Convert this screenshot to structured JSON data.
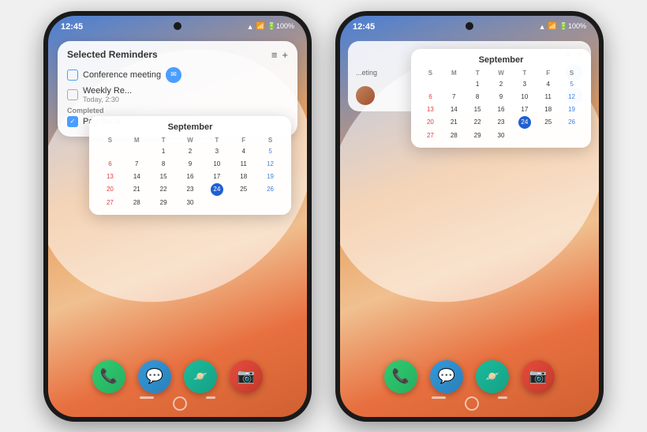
{
  "phone1": {
    "status": {
      "time": "12:45",
      "signal": "WiFi ▲ 100%"
    },
    "widget": {
      "title": "Selected Reminders",
      "items": [
        {
          "text": "Conference meeting",
          "sub": "",
          "checked": false,
          "tag": true
        },
        {
          "text": "Weekly Re...",
          "sub": "Today, 2:30",
          "checked": false,
          "tag": false
        }
      ],
      "completed_label": "Completed",
      "completed_items": [
        {
          "text": "Pay-the-b...",
          "checked": true
        }
      ]
    },
    "calendar": {
      "month": "September",
      "days_header": [
        "S",
        "M",
        "T",
        "W",
        "T",
        "F",
        "S"
      ],
      "rows": [
        [
          "",
          "",
          "1",
          "2",
          "3",
          "4",
          "5"
        ],
        [
          "6",
          "7",
          "8",
          "9",
          "10",
          "11",
          "12"
        ],
        [
          "13",
          "14",
          "15",
          "16",
          "17",
          "18",
          "19"
        ],
        [
          "20",
          "21",
          "22",
          "23",
          "24",
          "25",
          "26"
        ],
        [
          "27",
          "28",
          "29",
          "30",
          "",
          "",
          ""
        ]
      ],
      "today": "24"
    },
    "dock_apps": [
      "📞",
      "💬",
      "🛸",
      "📷"
    ],
    "nav": [
      "|||",
      "○",
      "‹"
    ]
  },
  "phone2": {
    "status": {
      "time": "12:45",
      "signal": "WiFi ▲ 100%"
    },
    "calendar": {
      "month": "September",
      "days_header": [
        "S",
        "M",
        "T",
        "W",
        "T",
        "F",
        "S"
      ],
      "rows": [
        [
          "",
          "",
          "1",
          "2",
          "3",
          "4",
          "5"
        ],
        [
          "6",
          "7",
          "8",
          "9",
          "10",
          "11",
          "12"
        ],
        [
          "13",
          "14",
          "15",
          "16",
          "17",
          "18",
          "19"
        ],
        [
          "20",
          "21",
          "22",
          "23",
          "24",
          "25",
          "26"
        ],
        [
          "27",
          "28",
          "29",
          "30",
          "",
          "",
          ""
        ]
      ],
      "today": "24"
    },
    "dock_apps": [
      "📞",
      "💬",
      "🛸",
      "📷"
    ],
    "nav": [
      "|||",
      "○",
      "‹"
    ]
  }
}
